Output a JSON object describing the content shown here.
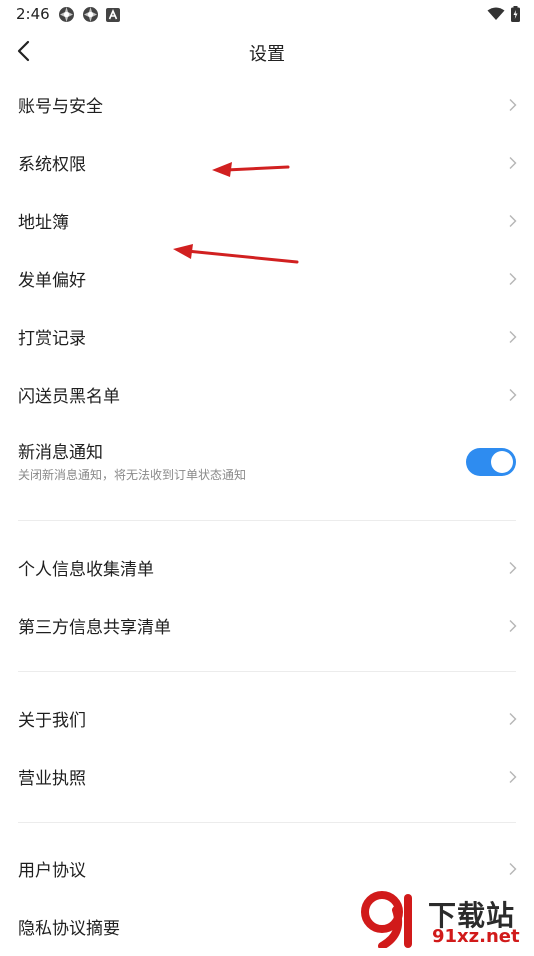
{
  "status": {
    "time": "2:46"
  },
  "header": {
    "title": "设置"
  },
  "rows": [
    {
      "label": "账号与安全"
    },
    {
      "label": "系统权限"
    },
    {
      "label": "地址簿"
    },
    {
      "label": "发单偏好"
    },
    {
      "label": "打赏记录"
    },
    {
      "label": "闪送员黑名单"
    }
  ],
  "notify": {
    "label": "新消息通知",
    "sub": "关闭新消息通知，将无法收到订单状态通知",
    "enabled": true
  },
  "rows2": [
    {
      "label": "个人信息收集清单"
    },
    {
      "label": "第三方信息共享清单"
    }
  ],
  "rows3": [
    {
      "label": "关于我们"
    },
    {
      "label": "营业执照"
    }
  ],
  "rows4": [
    {
      "label": "用户协议"
    },
    {
      "label": "隐私协议摘要"
    }
  ],
  "watermark": {
    "top": "下载站",
    "bottom": "91xz.net"
  },
  "colors": {
    "accent": "#2e8cf0",
    "arrow": "#d12020"
  }
}
